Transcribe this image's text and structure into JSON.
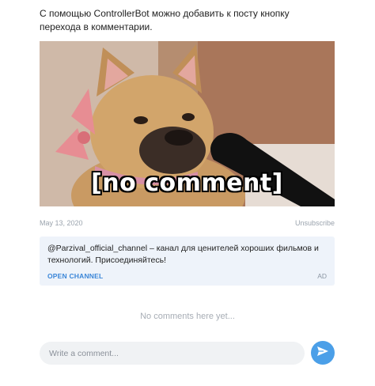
{
  "post": {
    "text": "С помощью ControllerBot можно добавить к посту кнопку перехода в комментарии.",
    "media_caption": "[no comment]",
    "date": "May 13, 2020",
    "unsubscribe_label": "Unsubscribe"
  },
  "ad": {
    "text": "@Parzival_official_channel – канал для ценителей хороших фильмов и технологий. Присоединяйтесь!",
    "open_label": "OPEN CHANNEL",
    "badge": "AD"
  },
  "comments": {
    "empty_text": "No comments here yet...",
    "input_placeholder": "Write a comment...",
    "send_icon": "send-icon"
  },
  "colors": {
    "accent": "#4b9fe8",
    "link": "#3b86d8",
    "ad_background": "#eef3fa",
    "input_background": "#f0f2f4"
  }
}
